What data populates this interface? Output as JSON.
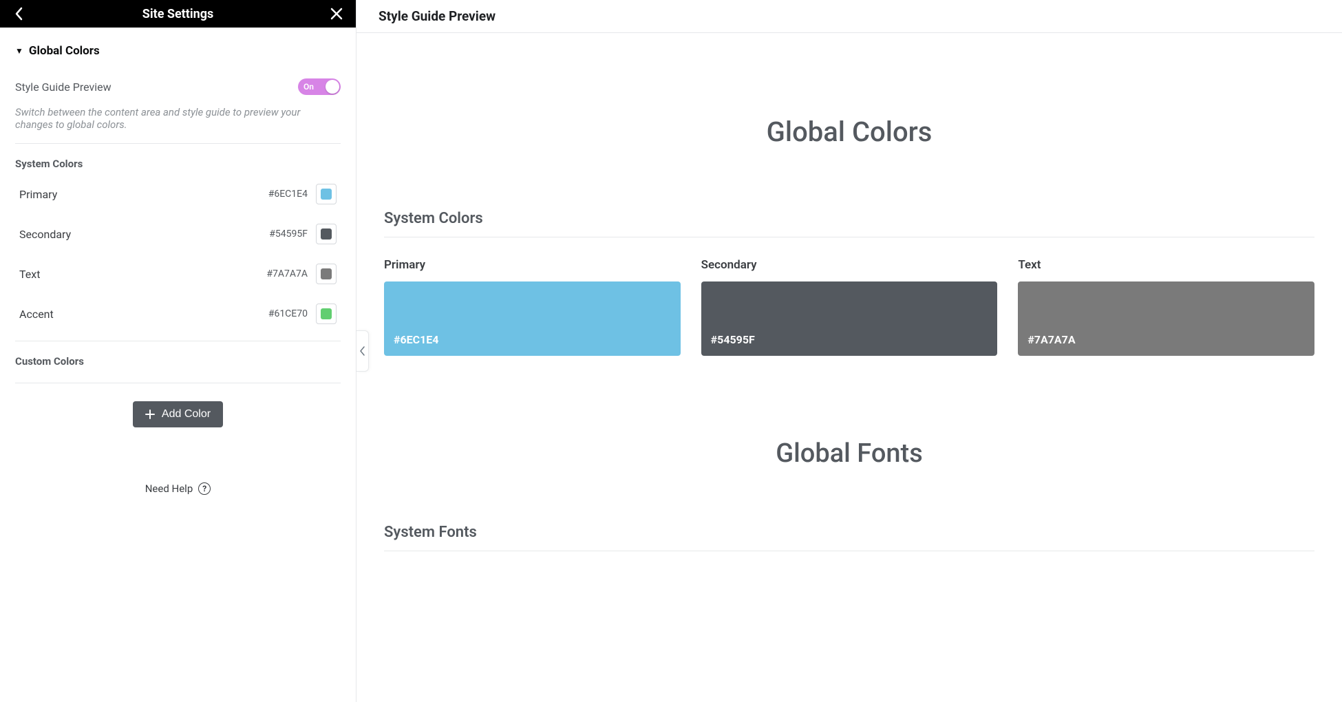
{
  "panel": {
    "title": "Site Settings",
    "section_title": "Global Colors",
    "toggle_label": "Style Guide Preview",
    "toggle_value": "On",
    "description": "Switch between the content area and style guide to preview your changes to global colors.",
    "system_colors_label": "System Colors",
    "colors": [
      {
        "name": "Primary",
        "hex": "#6EC1E4"
      },
      {
        "name": "Secondary",
        "hex": "#54595F"
      },
      {
        "name": "Text",
        "hex": "#7A7A7A"
      },
      {
        "name": "Accent",
        "hex": "#61CE70"
      }
    ],
    "custom_colors_label": "Custom Colors",
    "add_color_label": "Add Color",
    "need_help_label": "Need Help"
  },
  "preview": {
    "header": "Style Guide Preview",
    "hero_colors": "Global Colors",
    "system_colors_label": "System Colors",
    "cards": [
      {
        "name": "Primary",
        "hex": "#6EC1E4"
      },
      {
        "name": "Secondary",
        "hex": "#54595F"
      },
      {
        "name": "Text",
        "hex": "#7A7A7A"
      }
    ],
    "hero_fonts": "Global Fonts",
    "system_fonts_label": "System Fonts"
  }
}
